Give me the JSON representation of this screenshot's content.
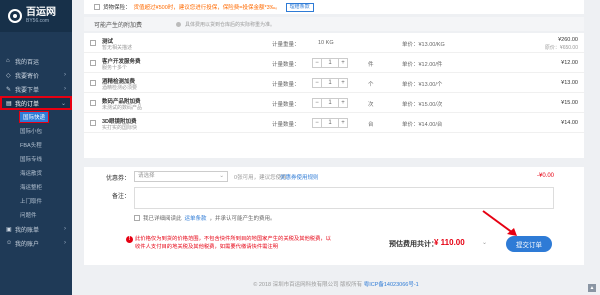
{
  "brand": {
    "name_cn": "百运网",
    "name_en": "BY56.com"
  },
  "sidebar": {
    "items": [
      {
        "label": "我的百运"
      },
      {
        "label": "我要寄价"
      },
      {
        "label": "我要下单"
      },
      {
        "label": "我的订单"
      },
      {
        "label": "我的账单"
      },
      {
        "label": "我的账户"
      }
    ],
    "sub_items": [
      {
        "label": "国际快递"
      },
      {
        "label": "国际小包"
      },
      {
        "label": "FBA头程"
      },
      {
        "label": "国际专线"
      },
      {
        "label": "海运散货"
      },
      {
        "label": "海运整柜"
      },
      {
        "label": "上门取件"
      },
      {
        "label": "问题件"
      }
    ]
  },
  "top_bar": {
    "insurance_label": "货物保险：",
    "insurance_text": "货值超过¥500时，建议您进行投保，保险费=投保金额*3‰。",
    "insurance_button": "理赔条款"
  },
  "addon_header": {
    "title": "可能产生的附加费",
    "note": "具体费用以货到仓库后的实际称重为准。"
  },
  "addons": [
    {
      "name": "测试",
      "desc": "暂无相关描述",
      "qty_label": "计量重量：",
      "qty_value": "10 KG",
      "unit_price": "单价：¥13.00/KG",
      "total": "¥260.00",
      "total_note": "原价：¥650.00"
    },
    {
      "name": "客户开发服务费",
      "desc": "服务十多个",
      "qty_label": "计量数量：",
      "qty": "1",
      "unit": "件",
      "unit_price": "单价：¥12.00/件",
      "total": "¥12.00"
    },
    {
      "name": "酒精检测加费",
      "desc": "酒精检测必须要",
      "qty_label": "计量数量：",
      "qty": "1",
      "unit": "个",
      "unit_price": "单价：¥13.00/个",
      "total": "¥13.00"
    },
    {
      "name": "数码产品附加费",
      "desc": "未测试的数码产品",
      "qty_label": "计量数量：",
      "qty": "1",
      "unit": "次",
      "unit_price": "单价：¥15.00/次",
      "total": "¥15.00"
    },
    {
      "name": "3D眼镜附加费",
      "desc": "实打实的国际快",
      "qty_label": "计量数量：",
      "qty": "1",
      "unit": "台",
      "unit_price": "单价：¥14.00/台",
      "total": "¥14.00"
    }
  ],
  "order_panel": {
    "coupon_label": "优惠券：",
    "coupon_placeholder": "请选择",
    "coupon_tip": "优惠券使用规则",
    "coupon_tip_prefix": "0",
    "coupon_tip_mid": "张可用，建议您使用",
    "coupon_rules": "优惠券使用规则",
    "coupon_amount": "-¥0.00",
    "remark_label": "备注：",
    "agree_prefix": "我已详细阅读此",
    "agree_link": "运单条款",
    "agree_suffix": "，并承认可能产生的费用。",
    "warning": "此价格仅为到货的价格范围，不包含快件所到目的地国家产生的关税及其他税费，以收件人支付目的地关税及其他税费，如需要代缴请快件需注明",
    "warning_icon": "!",
    "est_label": "预估费用共计：",
    "est_value": "¥ 110.00",
    "submit": "提交订单"
  },
  "footer": {
    "copyright": "© 2018 深圳市百运网科技有限公司 版权所有",
    "icp": "粤ICP备14023066号-1"
  },
  "colors": {
    "brand_blue": "#2e7bd6",
    "sidebar": "#1f3a57",
    "alert_red": "#e60012"
  }
}
